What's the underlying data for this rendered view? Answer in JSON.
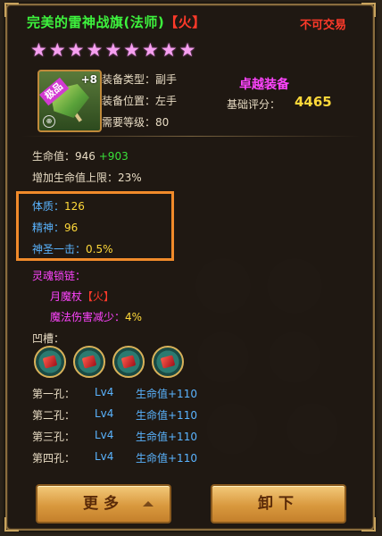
{
  "item": {
    "name": "完美的雷神战旗(法师)",
    "element_tag": "【火】",
    "tradeable": "不可交易",
    "stars": 9,
    "enhance": "+8",
    "quality_tag": "极品",
    "type_label": "装备类型：",
    "type_value": "副手",
    "position_label": "装备位置：",
    "position_value": "左手",
    "level_label": "需要等级：",
    "level_value": "80",
    "quality_name": "卓越装备",
    "score_label": "基础评分：",
    "score_value": "4465"
  },
  "stats": {
    "hp_label": "生命值：",
    "hp_base": "946",
    "hp_bonus": "+903",
    "hp_max_label": "增加生命值上限：",
    "hp_max_value": "23%",
    "con_label": "体质：",
    "con_value": "126",
    "spirit_label": "精神：",
    "spirit_value": "96",
    "holy_label": "神圣一击：",
    "holy_value": "0.5%"
  },
  "soul": {
    "title": "灵魂锁链：",
    "item_name": "月魔杖",
    "item_tag": "【火】",
    "effect_label": "魔法伤害减少：",
    "effect_value": "4%"
  },
  "slots": {
    "title": "凹槽：",
    "holes": [
      {
        "name": "第一孔：",
        "level": "Lv4",
        "attr": "生命值+110"
      },
      {
        "name": "第二孔：",
        "level": "Lv4",
        "attr": "生命值+110"
      },
      {
        "name": "第三孔：",
        "level": "Lv4",
        "attr": "生命值+110"
      },
      {
        "name": "第四孔：",
        "level": "Lv4",
        "attr": "生命值+110"
      }
    ]
  },
  "buttons": {
    "more": "更多",
    "unequip": "卸下"
  },
  "colors": {
    "title_green": "#3df23d",
    "element_red": "#ff3a2a",
    "excellent_purple": "#ff44ff",
    "score_yellow": "#ffd93a",
    "attr_blue": "#5ab4ff",
    "highlight_orange": "#f08a2a"
  }
}
